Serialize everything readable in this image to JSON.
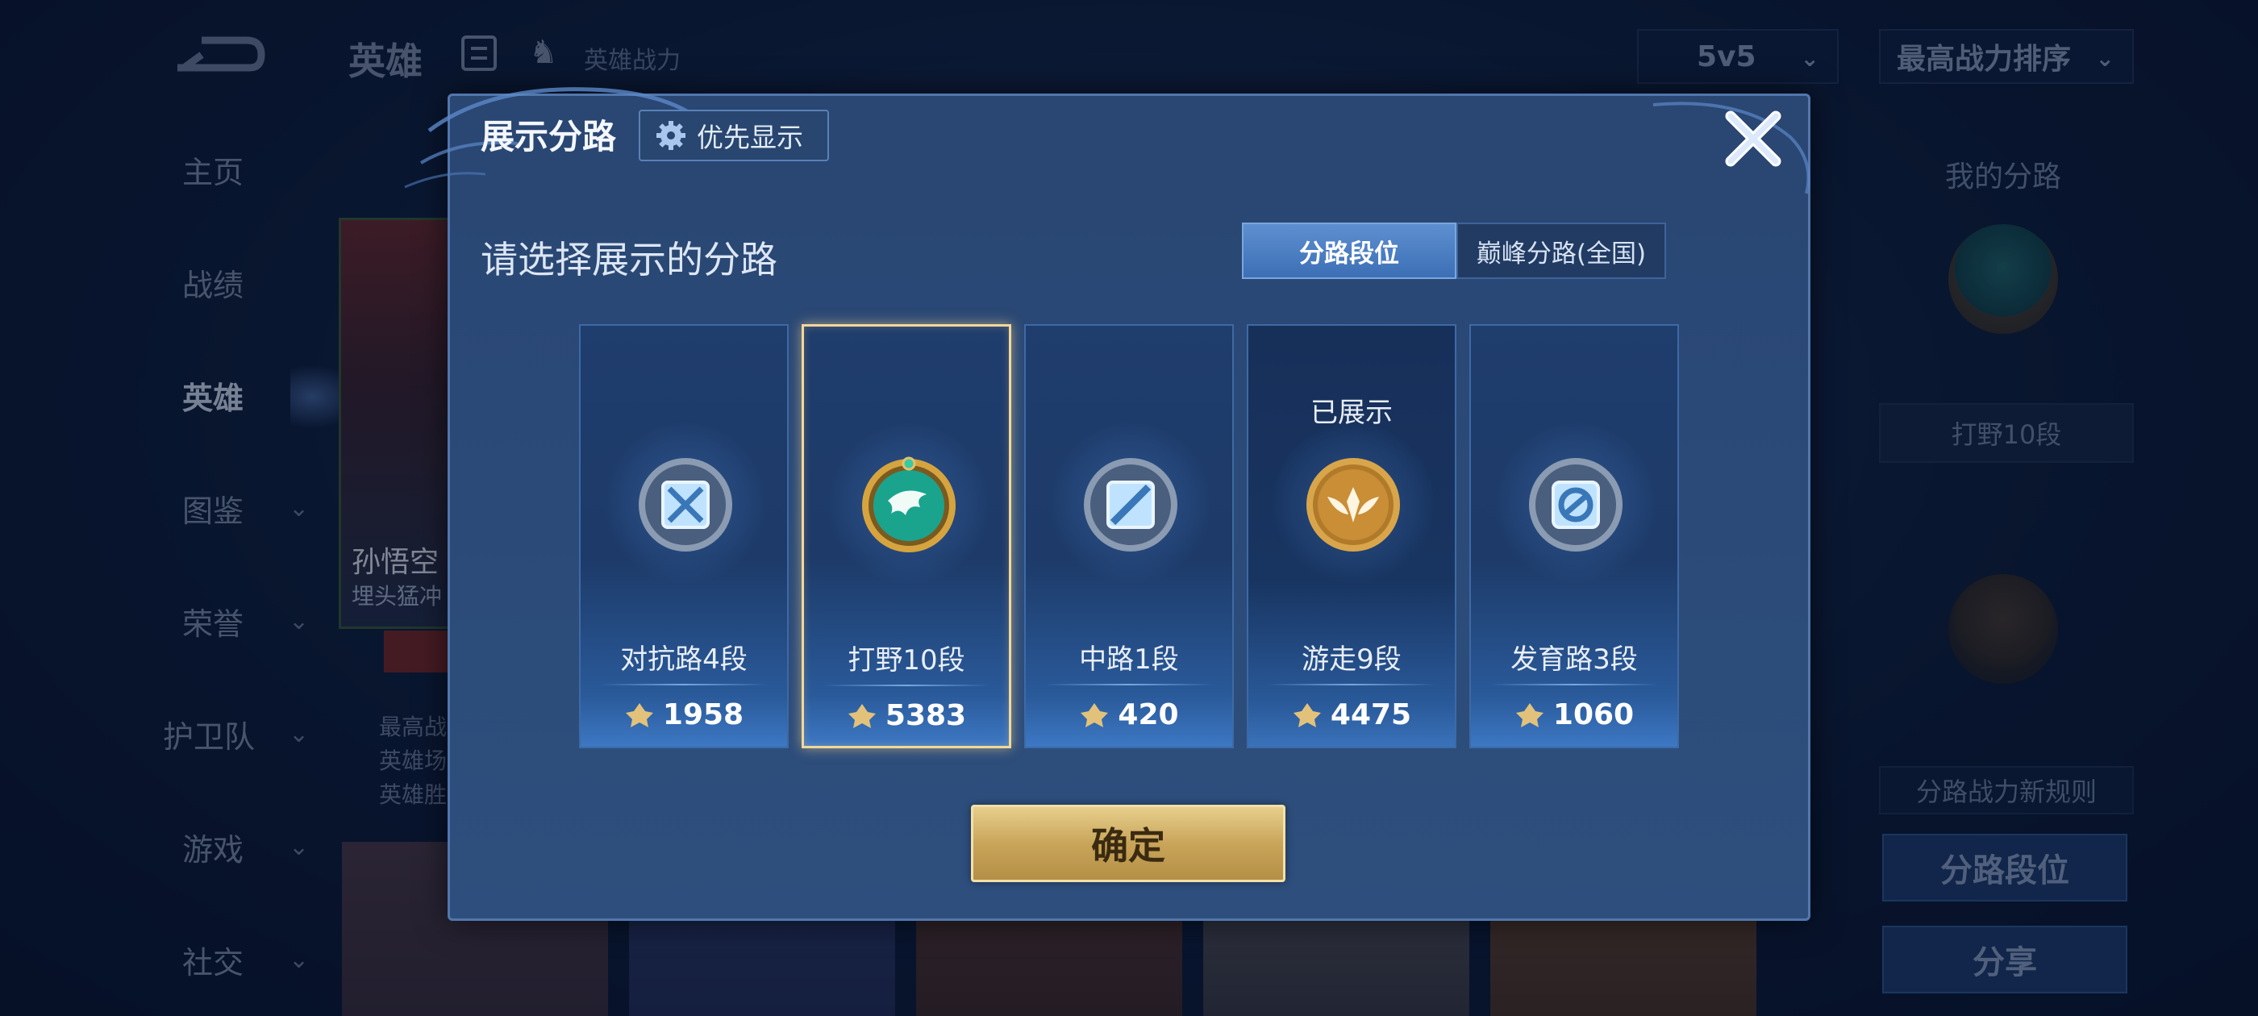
{
  "topbar": {
    "title": "英雄",
    "power_label": "英雄战力",
    "mode_select": "5v5",
    "sort_select": "最高战力排序"
  },
  "sidebar": {
    "items": [
      {
        "label": "主页"
      },
      {
        "label": "战绩"
      },
      {
        "label": "英雄"
      },
      {
        "label": "图鉴"
      },
      {
        "label": "荣誉"
      },
      {
        "label": "护卫队"
      },
      {
        "label": "游戏"
      },
      {
        "label": "社交"
      }
    ]
  },
  "hero_card": {
    "name": "孙悟空",
    "subtitle": "埋头猛冲",
    "stats": [
      "最高战",
      "英雄场",
      "英雄胜"
    ]
  },
  "right_panel": {
    "title": "我的分路",
    "current_role": "打野10段",
    "new_rule": "分路战力新规则",
    "role_rank_button": "分路段位",
    "share_button": "分享"
  },
  "modal": {
    "title": "展示分路",
    "priority_button": "优先显示",
    "subtitle": "请选择展示的分路",
    "tabs": [
      "分路段位",
      "巅峰分路(全国)"
    ],
    "active_tab": 0,
    "shown_label": "已展示",
    "roles": [
      {
        "name": "对抗路4段",
        "score": "1958",
        "emblem": "clash-lane-icon"
      },
      {
        "name": "打野10段",
        "score": "5383",
        "emblem": "jungle-dragon-icon"
      },
      {
        "name": "中路1段",
        "score": "420",
        "emblem": "mid-lane-icon"
      },
      {
        "name": "游走9段",
        "score": "4475",
        "emblem": "roam-wings-icon"
      },
      {
        "name": "发育路3段",
        "score": "1060",
        "emblem": "farm-lane-icon"
      }
    ],
    "confirm_button": "确定"
  },
  "colors": {
    "modal_bg": "#2b4a78",
    "accent_tab": "#4a7cc2",
    "confirm_gold": "#c9a55a",
    "selected_border": "#f1d79a"
  }
}
